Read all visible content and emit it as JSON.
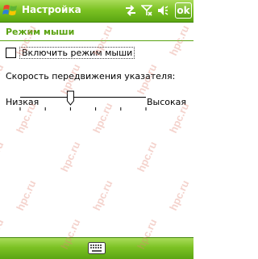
{
  "title_bar": {
    "title": "Настройка",
    "ok_label": "ok",
    "icons": [
      "windows-logo-icon",
      "sync-arrows-icon",
      "no-signal-antenna-icon",
      "speaker-icon"
    ]
  },
  "page": {
    "header": "Режим мыши",
    "checkbox": {
      "label": "Включить режим мыши",
      "checked": false
    },
    "slider": {
      "label": "Скорость передвижения указателя:",
      "min_label": "Низкая",
      "max_label": "Высокая",
      "ticks": 6,
      "position_index": 2
    }
  },
  "bottom_bar": {
    "icons": [
      "keyboard-icon"
    ]
  },
  "watermark": "hpc.ru",
  "colors": {
    "accent": "#5ba313",
    "titlebar_top": "#a9dc5a",
    "titlebar_bottom": "#5aa512",
    "watermark": "#e08070"
  }
}
